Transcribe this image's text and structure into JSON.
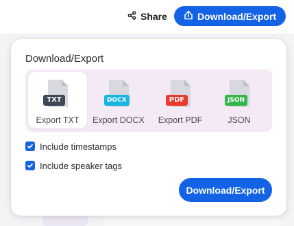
{
  "header": {
    "share_label": "Share",
    "export_label": "Download/Export",
    "share_icon": "share-icon",
    "export_icon": "upload-icon"
  },
  "panel": {
    "title": "Download/Export",
    "formats": [
      {
        "tag": "TXT",
        "label": "Export TXT",
        "color": "#3d4756",
        "selected": true
      },
      {
        "tag": "DOCX",
        "label": "Export DOCX",
        "color": "#19b5e0",
        "selected": false
      },
      {
        "tag": "PDF",
        "label": "Export PDF",
        "color": "#e93a30",
        "selected": false
      },
      {
        "tag": "JSON",
        "label": "JSON",
        "color": "#34b74a",
        "selected": false
      }
    ],
    "options": [
      {
        "label": "Include timestamps",
        "checked": true
      },
      {
        "label": "Include speaker tags",
        "checked": true
      }
    ],
    "export_button": "Download/Export"
  },
  "colors": {
    "accent": "#1463e6",
    "format_strip": "#f3eaf5"
  }
}
